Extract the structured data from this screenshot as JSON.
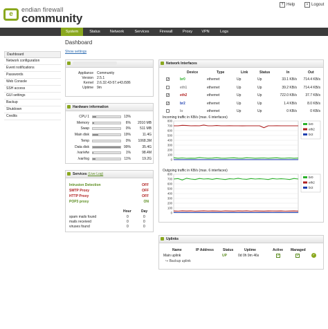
{
  "header": {
    "logo_line1": "endian firewall",
    "logo_line2": "community",
    "help": "Help",
    "logout": "Logout"
  },
  "nav": [
    "System",
    "Status",
    "Network",
    "Services",
    "Firewall",
    "Proxy",
    "VPN",
    "Logs"
  ],
  "sidebar": [
    "Dashboard",
    "Network configuration",
    "Event notifications",
    "Passwords",
    "Web Console",
    "SSH access",
    "GUI settings",
    "Backup",
    "Shutdown",
    "Credits"
  ],
  "page": {
    "title": "Dashboard",
    "show_settings": "Show settings"
  },
  "sysinfo": {
    "rows": [
      {
        "label": "Appliance",
        "value": "Community"
      },
      {
        "label": "Version",
        "value": "2.5.1"
      },
      {
        "label": "Kernel",
        "value": "2.6.32.43-57.e43.i586"
      },
      {
        "label": "Uptime",
        "value": "9m"
      }
    ]
  },
  "hardware": {
    "title": "Hardware information",
    "rows": [
      {
        "label": "CPU 1",
        "pct": "13%",
        "value": "",
        "frac": 0.13
      },
      {
        "label": "Memory",
        "pct": "6%",
        "value": "2010 MB",
        "frac": 0.06
      },
      {
        "label": "Swap",
        "pct": "0%",
        "value": "511 MB",
        "frac": 0.0
      },
      {
        "label": "Main disk",
        "pct": "19%",
        "value": "11.4G",
        "frac": 0.19
      },
      {
        "label": "Temp",
        "pct": "0%",
        "value": "1068.3M",
        "frac": 0.0
      },
      {
        "label": "Data disk",
        "pct": "99%",
        "value": "35.4G",
        "frac": 0.99
      },
      {
        "label": "/var/efw",
        "pct": "1%",
        "value": "98.4M",
        "frac": 0.01
      },
      {
        "label": "/var/log",
        "pct": "11%",
        "value": "19.2G",
        "frac": 0.11
      }
    ]
  },
  "services": {
    "title": "Services",
    "live_log": "(Live Log)",
    "items": [
      {
        "name": "Intrusion Detection",
        "status": "OFF"
      },
      {
        "name": "SMTP Proxy",
        "status": "OFF"
      },
      {
        "name": "HTTP Proxy",
        "status": "OFF"
      },
      {
        "name": "POP3 proxy",
        "status": "ON"
      }
    ],
    "stats_headers": [
      "Hour",
      "Day"
    ],
    "stats": [
      {
        "label": "spam mails found",
        "hour": "0",
        "day": "0"
      },
      {
        "label": "mails received",
        "hour": "0",
        "day": "0"
      },
      {
        "label": "viruses found",
        "hour": "0",
        "day": "0"
      }
    ]
  },
  "netif": {
    "title": "Network Interfaces",
    "headers": [
      "Device",
      "Type",
      "Link",
      "Status",
      "In",
      "Out"
    ],
    "rows": [
      {
        "checked": true,
        "device": "br0",
        "type": "ethernet",
        "link": "Up",
        "status": "Up",
        "in": "33.1 KB/s",
        "out": "714.4 KB/s",
        "color": "#2bb02b"
      },
      {
        "checked": false,
        "device": "eth1",
        "type": "ethernet",
        "link": "Up",
        "status": "Up",
        "in": "39.2 KB/s",
        "out": "714.4 KB/s",
        "color": "#888888"
      },
      {
        "checked": true,
        "device": "eth2",
        "type": "ethernet",
        "link": "Up",
        "status": "Up",
        "in": "722.0 KB/s",
        "out": "37.7 KB/s",
        "color": "#b02020"
      },
      {
        "checked": true,
        "device": "br2",
        "type": "ethernet",
        "link": "Up",
        "status": "Up",
        "in": "1.4 KB/s",
        "out": "8.0 KB/s",
        "color": "#2040b0"
      },
      {
        "checked": false,
        "device": "lo",
        "type": "ethernet",
        "link": "Up",
        "status": "Up",
        "in": "0 KB/s",
        "out": "0 KB/s",
        "color": "#888888"
      }
    ]
  },
  "charts": {
    "incoming_title": "Incoming traffic in KB/s (max. 6 interfaces)",
    "outgoing_title": "Outgoing traffic in KB/s (max. 6 interfaces)",
    "legend": [
      {
        "name": "br0",
        "color": "#2bb02b"
      },
      {
        "name": "eth2",
        "color": "#b02020"
      },
      {
        "name": "br2",
        "color": "#2040b0"
      }
    ]
  },
  "chart_data": [
    {
      "type": "line",
      "title": "Incoming traffic in KB/s (max. 6 interfaces)",
      "ylim": [
        0,
        800
      ],
      "yticks": [
        0,
        100,
        200,
        300,
        400,
        500,
        600,
        700,
        800
      ],
      "x": [
        0,
        1,
        2,
        3,
        4,
        5,
        6,
        7,
        8,
        9,
        10,
        11,
        12,
        13,
        14,
        15,
        16,
        17,
        18,
        19,
        20,
        21,
        22,
        23,
        24,
        25,
        26,
        27,
        28,
        29
      ],
      "series": [
        {
          "name": "eth2",
          "color": "#b02020",
          "values": [
            700,
            700,
            710,
            705,
            700,
            702,
            700,
            715,
            700,
            700,
            705,
            700,
            700,
            702,
            700,
            700,
            698,
            700,
            700,
            700,
            700,
            660,
            700,
            700,
            702,
            700,
            700,
            700,
            700,
            700
          ]
        },
        {
          "name": "br0",
          "color": "#2bb02b",
          "values": [
            40,
            30,
            35,
            28,
            32,
            30,
            45,
            35,
            30,
            33,
            40,
            32,
            30,
            35,
            38,
            32,
            30,
            40,
            35,
            30,
            33,
            36,
            30,
            34,
            38,
            30,
            32,
            35,
            30,
            33
          ]
        },
        {
          "name": "br2",
          "color": "#2040b0",
          "values": [
            2,
            1,
            2,
            1,
            1,
            2,
            1,
            1,
            2,
            1,
            1,
            1,
            2,
            1,
            1,
            2,
            1,
            1,
            1,
            2,
            1,
            1,
            2,
            1,
            1,
            1,
            2,
            1,
            1,
            1
          ]
        }
      ],
      "grid": true,
      "legend": "right"
    },
    {
      "type": "line",
      "title": "Outgoing traffic in KB/s (max. 6 interfaces)",
      "ylim": [
        0,
        800
      ],
      "yticks": [
        0,
        100,
        200,
        300,
        400,
        500,
        600,
        700,
        800
      ],
      "x": [
        0,
        1,
        2,
        3,
        4,
        5,
        6,
        7,
        8,
        9,
        10,
        11,
        12,
        13,
        14,
        15,
        16,
        17,
        18,
        19,
        20,
        21,
        22,
        23,
        24,
        25,
        26,
        27,
        28,
        29
      ],
      "series": [
        {
          "name": "br0",
          "color": "#2bb02b",
          "values": [
            700,
            710,
            680,
            715,
            700,
            690,
            712,
            700,
            705,
            695,
            710,
            700,
            690,
            705,
            700,
            715,
            700,
            695,
            710,
            700,
            705,
            700,
            690,
            710,
            700,
            705,
            700,
            690,
            712,
            700
          ]
        },
        {
          "name": "eth2",
          "color": "#b02020",
          "values": [
            40,
            35,
            42,
            38,
            40,
            36,
            38,
            41,
            37,
            40,
            38,
            36,
            40,
            39,
            37,
            40,
            38,
            41,
            36,
            40,
            38,
            37,
            40,
            39,
            38,
            40,
            36,
            38,
            40,
            37
          ]
        },
        {
          "name": "br2",
          "color": "#2040b0",
          "values": [
            8,
            7,
            9,
            8,
            7,
            8,
            9,
            8,
            7,
            8,
            8,
            9,
            7,
            8,
            8,
            7,
            9,
            8,
            8,
            7,
            8,
            9,
            8,
            7,
            8,
            8,
            7,
            9,
            8,
            8
          ]
        }
      ],
      "grid": true,
      "legend": "right"
    }
  ],
  "uplinks": {
    "title": "Uplinks",
    "headers": [
      "Name",
      "IP Address",
      "Status",
      "Uptime",
      "Active",
      "Managed"
    ],
    "row": {
      "name": "Main uplink",
      "ip": "",
      "status": "UP",
      "uptime": "0d 0h 9m 46s"
    },
    "backup": "Backup uplink"
  }
}
